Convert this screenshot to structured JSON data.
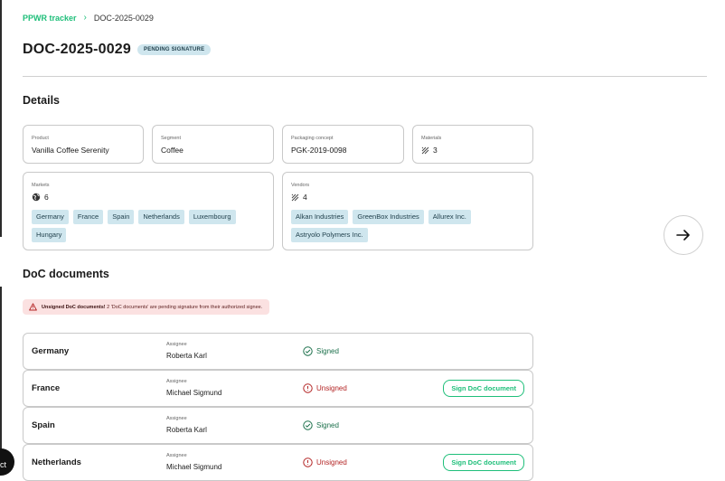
{
  "breadcrumb": {
    "root": "PPWR tracker",
    "current": "DOC-2025-0029"
  },
  "header": {
    "title": "DOC-2025-0029",
    "status": "PENDING SIGNATURE"
  },
  "details": {
    "title": "Details",
    "product": {
      "label": "Product",
      "value": "Vanilla Coffee Serenity"
    },
    "segment": {
      "label": "Segment",
      "value": "Coffee"
    },
    "packaging": {
      "label": "Packaging concept",
      "value": "PGK-2019-0098"
    },
    "materials": {
      "label": "Materials",
      "value": "3"
    },
    "markets": {
      "label": "Markets",
      "count": "6",
      "items": [
        "Germany",
        "France",
        "Spain",
        "Netherlands",
        "Luxembourg",
        "Hungary"
      ]
    },
    "vendors": {
      "label": "Vendors",
      "count": "4",
      "items": [
        "Alkan Industries",
        "GreenBox Industries",
        "Allurex Inc.",
        "Astryolo Polymers Inc."
      ]
    }
  },
  "doc": {
    "title": "DoC documents",
    "alert_bold": "Unsigned DoC documents!",
    "alert_text": " 2 'DoC documents' are pending signature from their authorized signee.",
    "assignee_label": "Assignee",
    "sign_label": "Sign DoC document",
    "rows": [
      {
        "country": "Germany",
        "assignee": "Roberta Karl",
        "status": "Signed"
      },
      {
        "country": "France",
        "assignee": "Michael Sigmund",
        "status": "Unsigned"
      },
      {
        "country": "Spain",
        "assignee": "Roberta Karl",
        "status": "Signed"
      },
      {
        "country": "Netherlands",
        "assignee": "Michael Sigmund",
        "status": "Unsigned"
      }
    ]
  },
  "corner_text": "ct",
  "colors": {
    "accent": "#1fbf7a",
    "chip": "#cfe6ee",
    "signed": "#1a6f4a",
    "unsigned": "#b32424",
    "alert_bg": "#fbe1e1"
  }
}
